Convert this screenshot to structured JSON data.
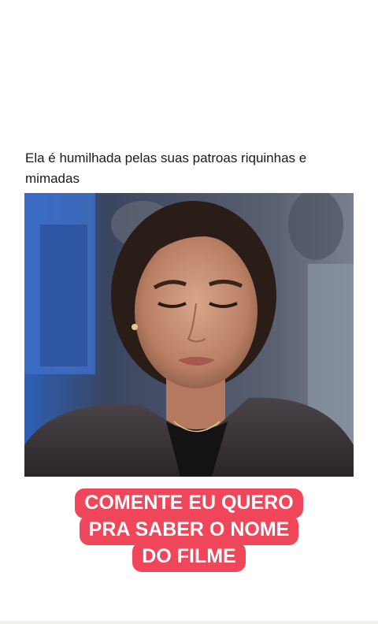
{
  "post": {
    "caption": "Ela é humilhada pelas suas patroas riquinhas e mimadas"
  },
  "media": {
    "description_icon": "video-still"
  },
  "overlay": {
    "lines": [
      "COMENTE EU QUERO",
      "PRA SABER O NOME",
      "DO FILME"
    ],
    "background_color": "#f0465a",
    "text_color": "#ffffff"
  }
}
